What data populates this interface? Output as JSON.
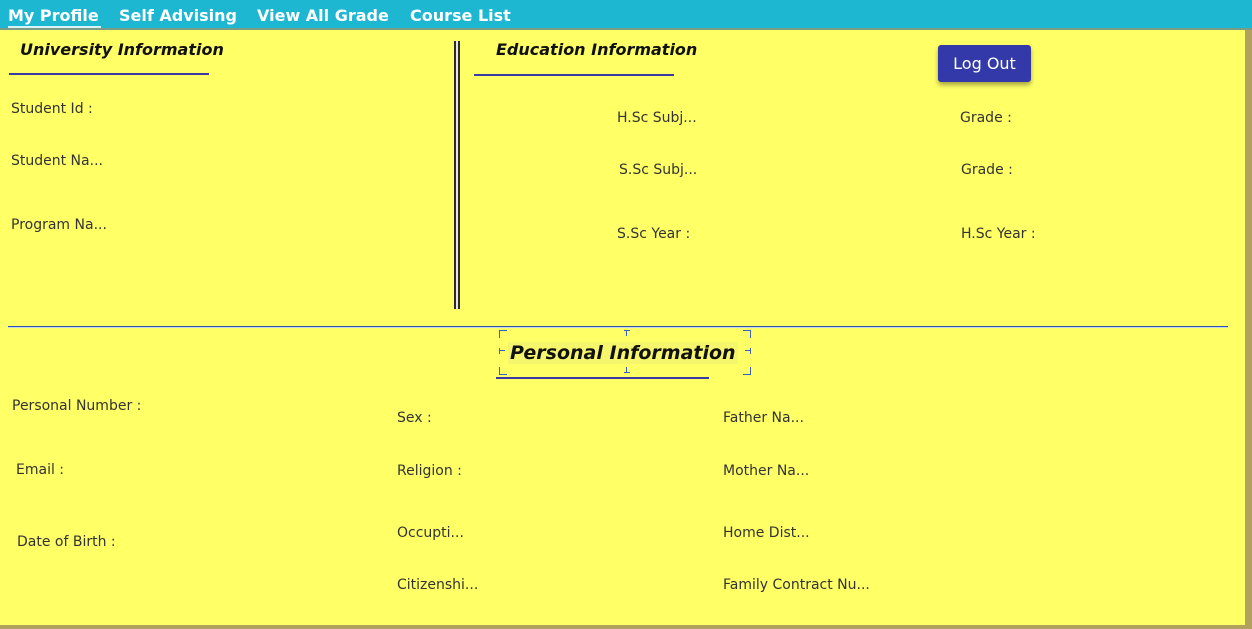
{
  "menu": {
    "items": [
      {
        "label": "My Profile"
      },
      {
        "label": "Self Advising"
      },
      {
        "label": "View All Grade"
      },
      {
        "label": "Course List"
      }
    ]
  },
  "university": {
    "title": "University Information",
    "student_id": "Student Id :",
    "student_name": "Student Na...",
    "program_name": "Program Na..."
  },
  "education": {
    "title": "Education Information",
    "hsc_subject": "H.Sc Subj...",
    "hsc_grade": "Grade :",
    "ssc_subject": "S.Sc Subj...",
    "ssc_grade": "Grade :",
    "ssc_year": "S.Sc Year :",
    "hsc_year": "H.Sc Year :"
  },
  "actions": {
    "logout_label": "Log Out"
  },
  "personal": {
    "title": "Personal Information",
    "personal_number": "Personal Number :",
    "email": "Email :",
    "date_of_birth": "Date of Birth :",
    "sex": "Sex :",
    "religion": "Religion :",
    "occupation": "Occupti...",
    "citizenship": "Citizenshi...",
    "father_name": "Father Na...",
    "mother_name": "Mother Na...",
    "home_district": "Home Dist...",
    "family_contact": "Family Contract Nu..."
  },
  "colors": {
    "menubar": "#1eb7d2",
    "panel": "#ffff66",
    "button": "#3339a8",
    "accent_line": "#3a3aa6"
  }
}
